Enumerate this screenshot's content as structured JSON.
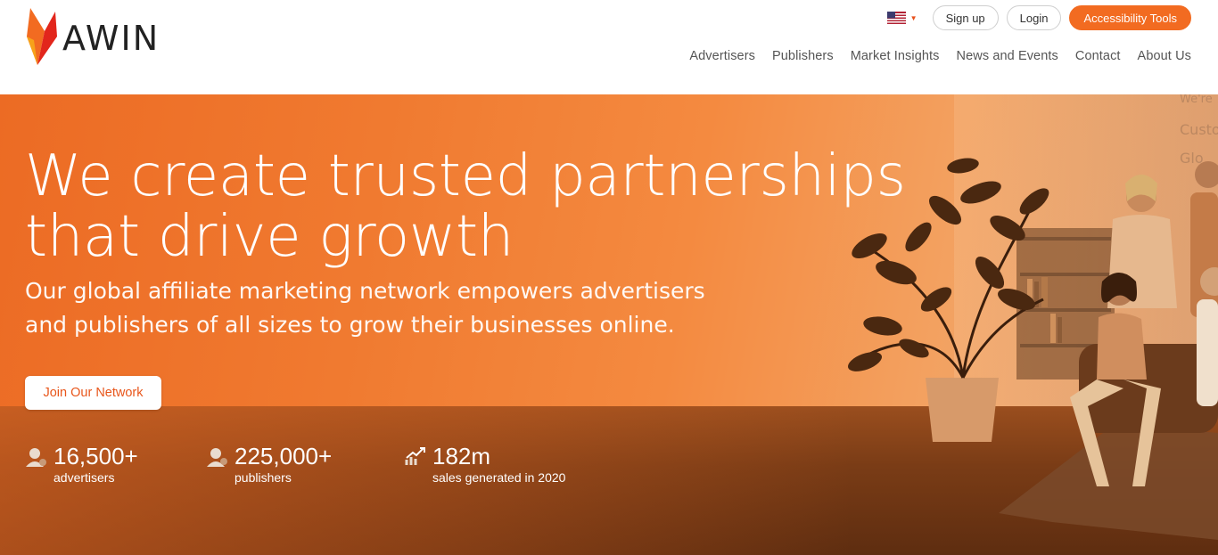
{
  "brand": {
    "name": "AWIN",
    "accent": "#f26b21"
  },
  "header": {
    "country_flag_icon": "us-flag-icon",
    "signup_label": "Sign up",
    "login_label": "Login",
    "accessibility_label": "Accessibility Tools",
    "nav": [
      {
        "label": "Advertisers"
      },
      {
        "label": "Publishers"
      },
      {
        "label": "Market Insights"
      },
      {
        "label": "News and Events"
      },
      {
        "label": "Contact"
      },
      {
        "label": "About Us"
      }
    ]
  },
  "hero": {
    "headline": "We create trusted partnerships that drive growth",
    "subheadline": "Our global affiliate marketing network empowers advertisers and publishers of all sizes to grow their businesses online.",
    "cta_label": "Join Our Network",
    "backwall_text": [
      "We're",
      "Custo",
      "Glo"
    ],
    "stats": [
      {
        "value": "16,500+",
        "label": "advertisers",
        "icon": "advertiser-icon"
      },
      {
        "value": "225,000+",
        "label": "publishers",
        "icon": "publisher-icon"
      },
      {
        "value": "182m",
        "label": "sales generated in 2020",
        "icon": "growth-chart-icon"
      }
    ]
  }
}
